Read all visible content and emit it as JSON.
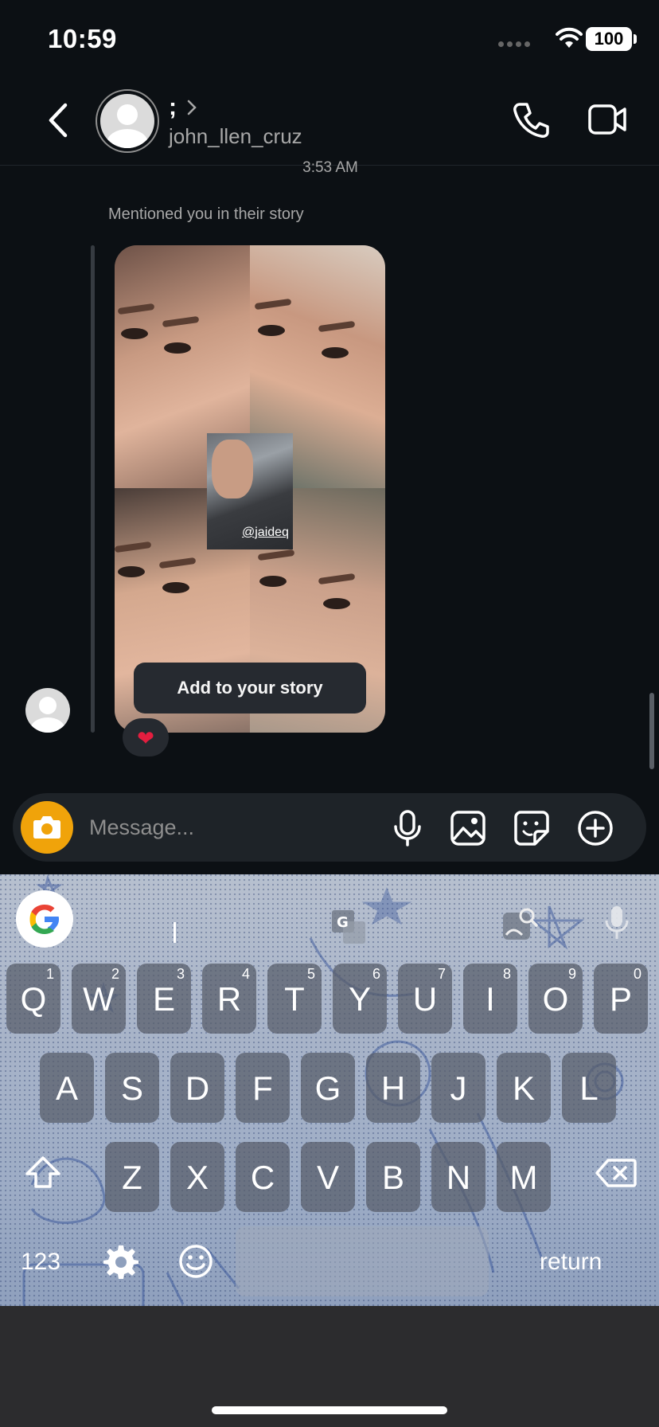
{
  "status_bar": {
    "time": "10:59",
    "battery": "100"
  },
  "header": {
    "display_name": ";",
    "username": "john_llen_cruz"
  },
  "chat": {
    "timestamp": "3:53 AM",
    "mention_text": "Mentioned you in their story",
    "story_tag": "@jaideq",
    "add_story_label": "Add to your story",
    "reaction": "❤"
  },
  "composer": {
    "placeholder": "Message..."
  },
  "keyboard": {
    "row1": [
      {
        "key": "Q",
        "hint": "1"
      },
      {
        "key": "W",
        "hint": "2"
      },
      {
        "key": "E",
        "hint": "3"
      },
      {
        "key": "R",
        "hint": "4"
      },
      {
        "key": "T",
        "hint": "5"
      },
      {
        "key": "Y",
        "hint": "6"
      },
      {
        "key": "U",
        "hint": "7"
      },
      {
        "key": "I",
        "hint": "8"
      },
      {
        "key": "O",
        "hint": "9"
      },
      {
        "key": "P",
        "hint": "0"
      }
    ],
    "row2": [
      "A",
      "S",
      "D",
      "F",
      "G",
      "H",
      "J",
      "K",
      "L"
    ],
    "row3": [
      "Z",
      "X",
      "C",
      "V",
      "B",
      "N",
      "M"
    ],
    "numbers_label": "123",
    "return_label": "return"
  },
  "colors": {
    "background": "#0c1014",
    "camera_button": "#f0a30a",
    "heart": "#e41e3f",
    "composer": "#1e2328"
  },
  "icons": [
    "back-chevron-icon",
    "phone-icon",
    "video-camera-icon",
    "camera-icon",
    "microphone-icon",
    "gallery-icon",
    "sticker-icon",
    "plus-circle-icon",
    "google-icon",
    "translate-icon",
    "image-search-icon",
    "shift-icon",
    "backspace-icon",
    "gear-icon",
    "emoji-icon"
  ]
}
